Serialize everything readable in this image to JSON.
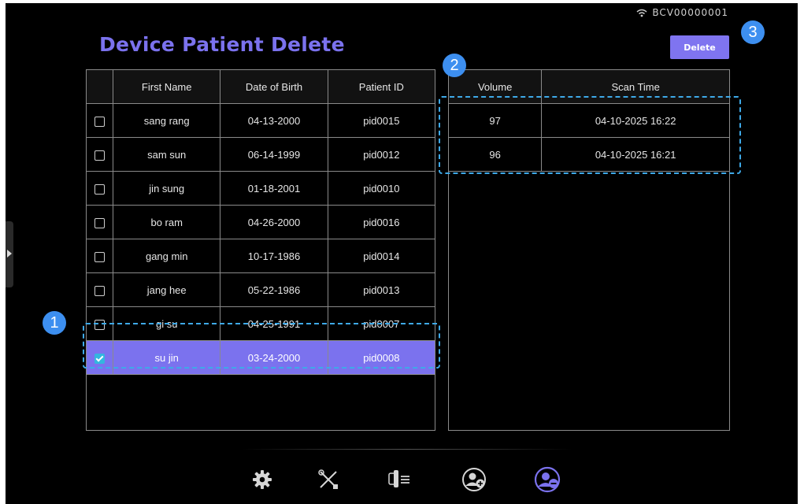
{
  "device_id": "BCV00000001",
  "page_title": "Device Patient Delete",
  "delete_label": "Delete",
  "badges": [
    "1",
    "2",
    "3"
  ],
  "patient_table": {
    "columns": [
      "First Name",
      "Date of Birth",
      "Patient ID"
    ],
    "rows": [
      {
        "first_name": "sang rang",
        "dob": "04-13-2000",
        "pid": "pid0015",
        "checked": false
      },
      {
        "first_name": "sam sun",
        "dob": "06-14-1999",
        "pid": "pid0012",
        "checked": false
      },
      {
        "first_name": "jin sung",
        "dob": "01-18-2001",
        "pid": "pid0010",
        "checked": false
      },
      {
        "first_name": "bo ram",
        "dob": "04-26-2000",
        "pid": "pid0016",
        "checked": false
      },
      {
        "first_name": "gang min",
        "dob": "10-17-1986",
        "pid": "pid0014",
        "checked": false
      },
      {
        "first_name": "jang hee",
        "dob": "05-22-1986",
        "pid": "pid0013",
        "checked": false
      },
      {
        "first_name": "gi su",
        "dob": "04-25-1991",
        "pid": "pid0007",
        "checked": false
      },
      {
        "first_name": "su jin",
        "dob": "03-24-2000",
        "pid": "pid0008",
        "checked": true
      }
    ]
  },
  "scan_table": {
    "columns": [
      "Volume",
      "Scan Time"
    ],
    "rows": [
      {
        "volume": "97",
        "scan_time": "04-10-2025 16:22"
      },
      {
        "volume": "96",
        "scan_time": "04-10-2025 16:21"
      }
    ]
  },
  "bottom_nav": [
    "gear-icon",
    "tools-icon",
    "scanner-list-icon",
    "add-patient-icon",
    "remove-patient-icon"
  ],
  "colors": {
    "accent": "#7b72ee",
    "highlight": "#3ea9e8",
    "badge": "#3d8ff0",
    "checkbox": "#33b6df"
  }
}
